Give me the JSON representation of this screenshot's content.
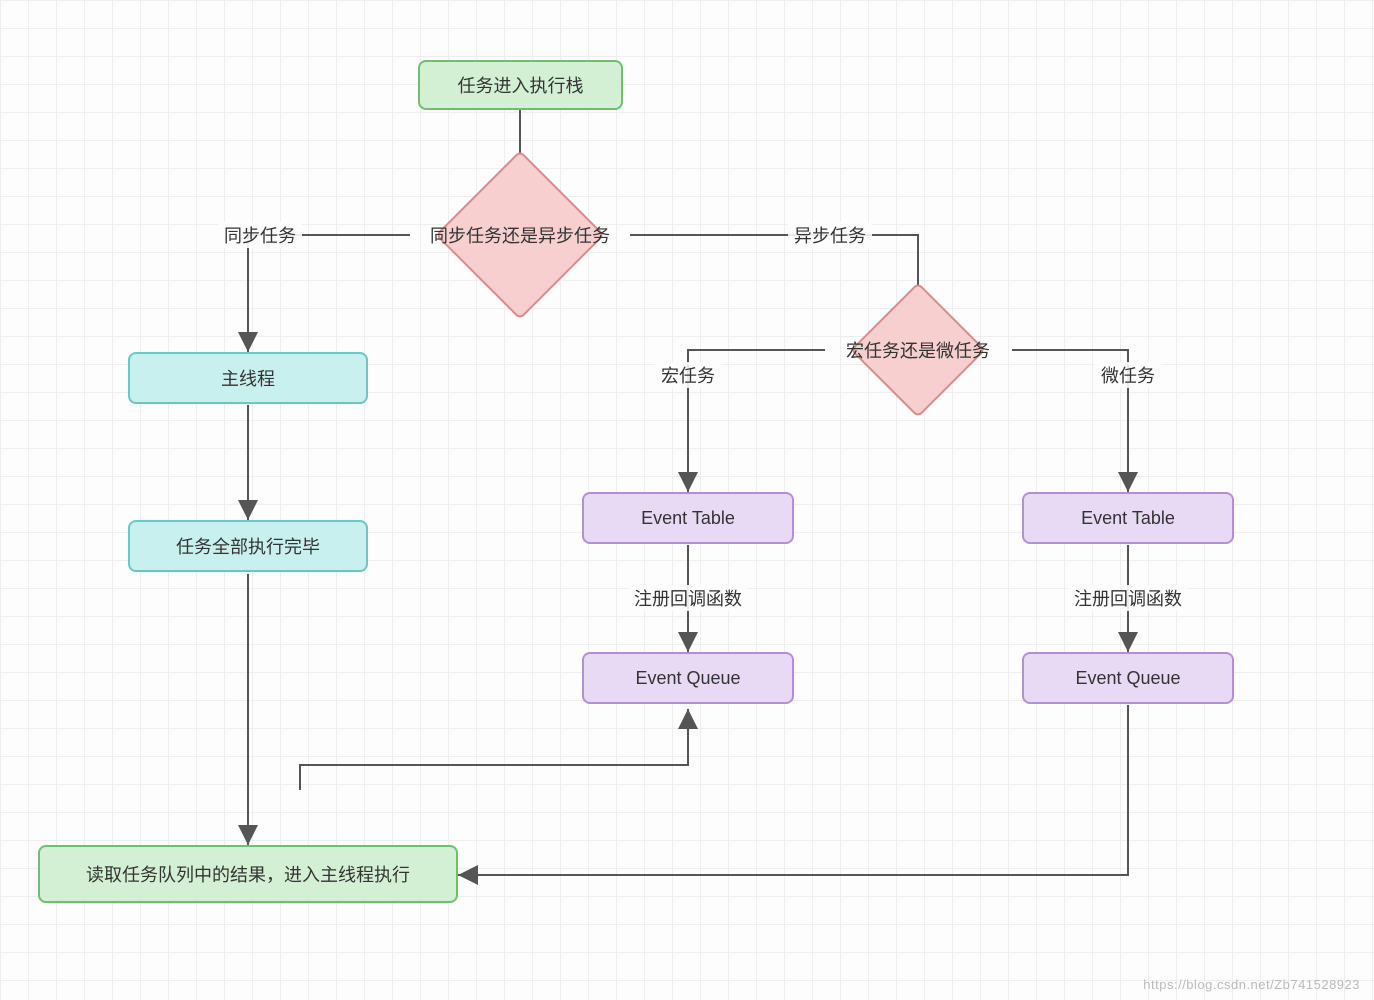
{
  "nodes": {
    "start": "任务进入执行栈",
    "decision1": "同步任务还是异步任务",
    "sync_label": "同步任务",
    "async_label": "异步任务",
    "main_thread": "主线程",
    "all_done": "任务全部执行完毕",
    "decision2": "宏任务还是微任务",
    "macro_label": "宏任务",
    "micro_label": "微任务",
    "event_table_macro": "Event Table",
    "event_table_micro": "Event Table",
    "register_callback_macro": "注册回调函数",
    "register_callback_micro": "注册回调函数",
    "event_queue_macro": "Event Queue",
    "event_queue_micro": "Event Queue",
    "finish": "读取任务队列中的结果，进入主线程执行"
  },
  "watermark": "https://blog.csdn.net/Zb741528923",
  "colors": {
    "green_fill": "#d4f0d4",
    "green_border": "#6fbf6f",
    "cyan_fill": "#c8f0ef",
    "cyan_border": "#6cc7c4",
    "purple_fill": "#e8d9f4",
    "purple_border": "#b48ed8",
    "pink_fill": "#f6cfce",
    "pink_border": "#d98b8a"
  }
}
